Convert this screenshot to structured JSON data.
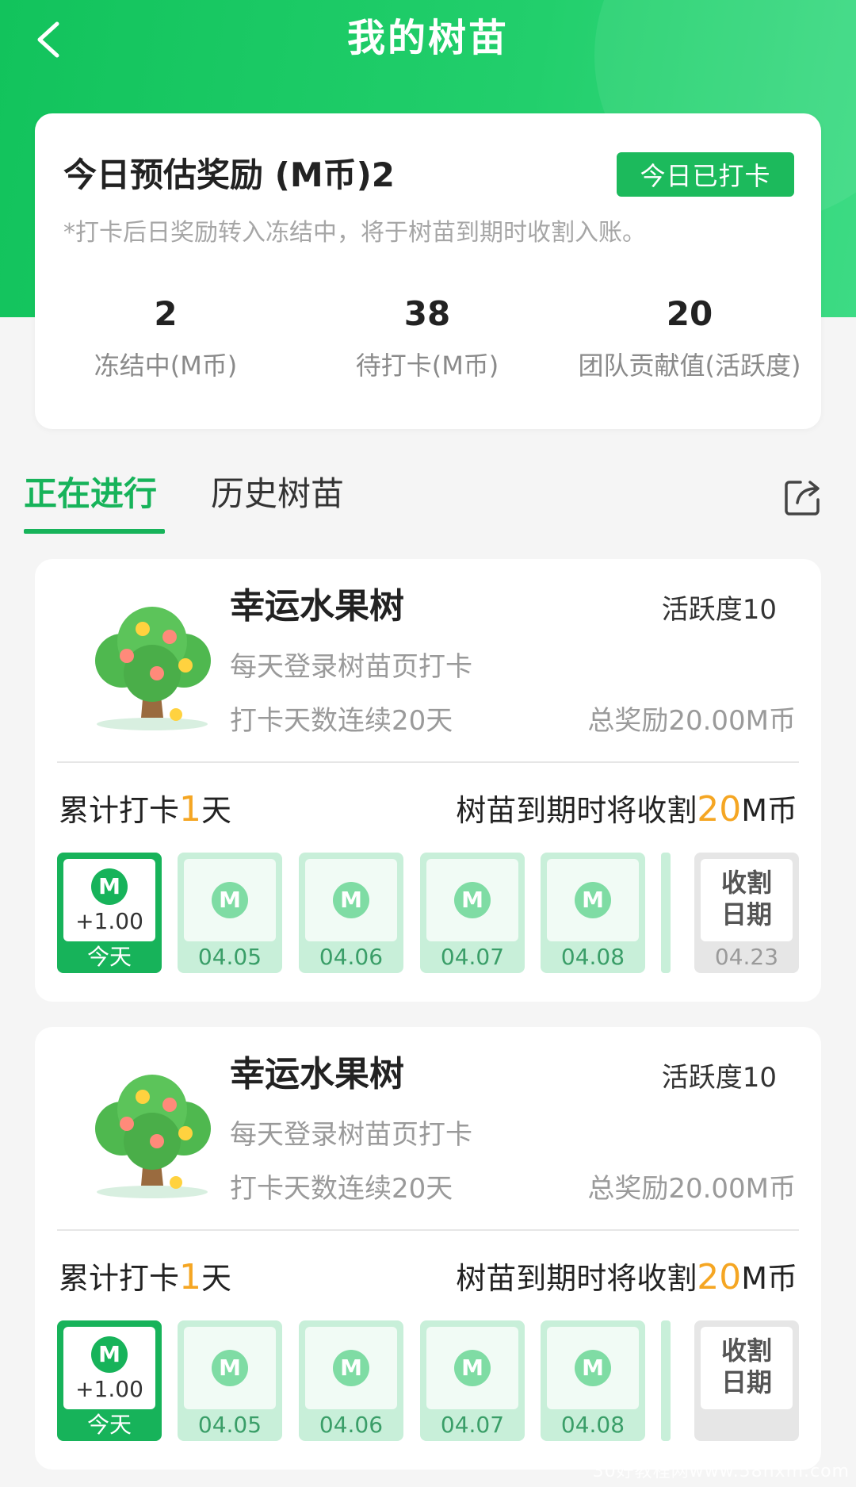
{
  "header": {
    "title": "我的树苗"
  },
  "summary": {
    "estimate_title": "今日预估奖励 (M币)2",
    "checked_badge": "今日已打卡",
    "note": "*打卡后日奖励转入冻结中，将于树苗到期时收割入账。",
    "stats": [
      {
        "value": "2",
        "label": "冻结中(M币)"
      },
      {
        "value": "38",
        "label": "待打卡(M币)"
      },
      {
        "value": "20",
        "label": "团队贡献值(活跃度)"
      }
    ]
  },
  "tabs": [
    {
      "label": "正在进行",
      "active": true
    },
    {
      "label": "历史树苗",
      "active": false
    }
  ],
  "saplings": [
    {
      "name": "幸运水果树",
      "activity": "活跃度10",
      "task": "每天登录树苗页打卡",
      "days": "打卡天数连续20天",
      "total": "总奖励20.00M币",
      "cum_prefix": "累计打卡",
      "cum_value": "1",
      "cum_suffix": "天",
      "harvest_prefix": "树苗到期时将收割",
      "harvest_value": "20",
      "harvest_suffix": "M币",
      "today": {
        "coin": "M",
        "amount": "+1.00",
        "label": "今天"
      },
      "days_tiles": [
        {
          "coin": "M",
          "date": "04.05"
        },
        {
          "coin": "M",
          "date": "04.06"
        },
        {
          "coin": "M",
          "date": "04.07"
        },
        {
          "coin": "M",
          "date": "04.08"
        }
      ],
      "harvest_tile": {
        "line1": "收割",
        "line2": "日期",
        "date": "04.23"
      }
    },
    {
      "name": "幸运水果树",
      "activity": "活跃度10",
      "task": "每天登录树苗页打卡",
      "days": "打卡天数连续20天",
      "total": "总奖励20.00M币",
      "cum_prefix": "累计打卡",
      "cum_value": "1",
      "cum_suffix": "天",
      "harvest_prefix": "树苗到期时将收割",
      "harvest_value": "20",
      "harvest_suffix": "M币",
      "today": {
        "coin": "M",
        "amount": "+1.00",
        "label": "今天"
      },
      "days_tiles": [
        {
          "coin": "M",
          "date": "04.05"
        },
        {
          "coin": "M",
          "date": "04.06"
        },
        {
          "coin": "M",
          "date": "04.07"
        },
        {
          "coin": "M",
          "date": "04.08"
        }
      ],
      "harvest_tile": {
        "line1": "收割",
        "line2": "日期",
        "date": ""
      }
    }
  ],
  "watermark": "30好教程网www.58hxm.com",
  "colors": {
    "brand_green": "#17b35a",
    "highlight_orange": "#f5a623"
  }
}
